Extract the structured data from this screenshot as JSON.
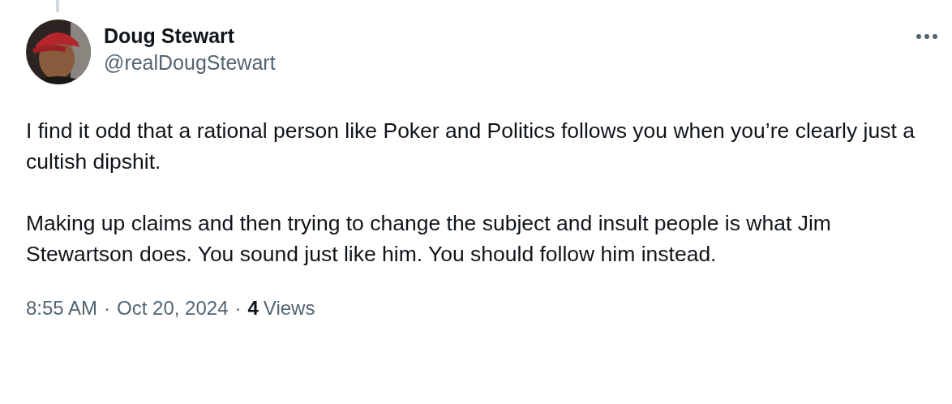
{
  "author": {
    "name": "Doug Stewart",
    "handle": "@realDougStewart"
  },
  "body": [
    "I find it odd that a rational person like Poker and Politics follows you when you’re clearly just a cultish dipshit.",
    "Making up claims and then trying to change the subject and insult people is what Jim Stewartson does. You sound just like him. You should follow him instead."
  ],
  "footer": {
    "time": "8:55 AM",
    "separator": "·",
    "date": "Oct 20, 2024",
    "views_count": "4",
    "views_label": "Views"
  }
}
